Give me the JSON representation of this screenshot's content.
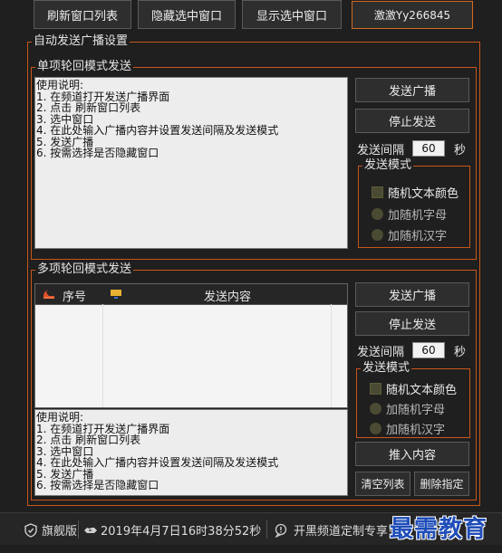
{
  "toolbar": {
    "refresh_list": "刷新窗口列表",
    "hide_selected": "隐藏选中窗口",
    "show_selected": "显示选中窗口",
    "author": "激激Yy266845"
  },
  "auto_broadcast": {
    "title": "自动发送广播设置",
    "single": {
      "title": "单项轮回模式发送",
      "instructions": [
        "使用说明:",
        "1. 在频道打开发送广播界面",
        "2. 点击 刷新窗口列表",
        "3. 选中窗口",
        "4. 在此处输入广播内容并设置发送间隔及发送模式",
        "5. 发送广播",
        "6. 按需选择是否隐藏窗口"
      ],
      "send_button": "发送广播",
      "stop_button": "停止发送",
      "interval_label": "发送间隔",
      "interval_value": "60",
      "interval_unit": "秒",
      "mode_title": "发送模式",
      "mode_options": [
        "随机文本颜色",
        "加随机字母",
        "加随机汉字"
      ]
    },
    "multi": {
      "title": "多项轮回模式发送",
      "columns": [
        "序号",
        "发送内容"
      ],
      "instructions": [
        "使用说明:",
        "1. 在频道打开发送广播界面",
        "2. 点击 刷新窗口列表",
        "3. 选中窗口",
        "4. 在此处输入广播内容并设置发送间隔及发送模式",
        "5. 发送广播",
        "6. 按需选择是否隐藏窗口"
      ],
      "send_button": "发送广播",
      "stop_button": "停止发送",
      "interval_label": "发送间隔",
      "interval_value": "60",
      "interval_unit": "秒",
      "mode_title": "发送模式",
      "mode_options": [
        "随机文本颜色",
        "加随机字母",
        "加随机汉字"
      ],
      "insert_button": "推入内容",
      "clear_button": "清空列表",
      "delete_button": "删除指定"
    }
  },
  "status_bar": {
    "edition": "旗舰版",
    "datetime": "2019年4月7日16时38分52秒",
    "promo": "开黑频道定制专享!"
  },
  "watermark": "最需教育",
  "colors": {
    "accent_border": "#c8561a",
    "background": "#1f1f1f",
    "watermark": "#1f4db8"
  }
}
